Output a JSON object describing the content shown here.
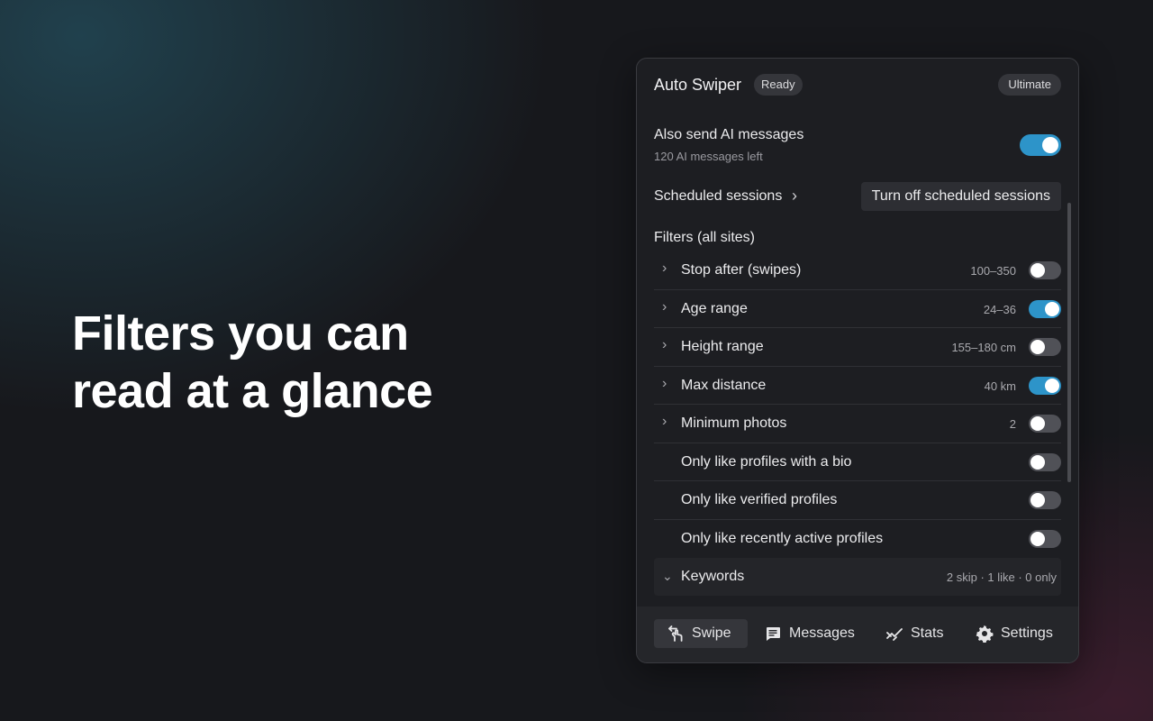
{
  "hero": {
    "headline": "Filters you can\nread at a glance"
  },
  "panel": {
    "title": "Auto Swiper",
    "status": "Ready",
    "plan": "Ultimate",
    "ai": {
      "label": "Also send AI messages",
      "sub": "120 AI messages left",
      "enabled": true
    },
    "scheduled": {
      "label": "Scheduled sessions",
      "button": "Turn off scheduled sessions"
    },
    "filters_heading": "Filters (all sites)",
    "filters": [
      {
        "label": "Stop after (swipes)",
        "value": "100–350",
        "enabled": false,
        "expandable": true
      },
      {
        "label": "Age range",
        "value": "24–36",
        "enabled": true,
        "expandable": true
      },
      {
        "label": "Height range",
        "value": "155–180 cm",
        "enabled": false,
        "expandable": true
      },
      {
        "label": "Max distance",
        "value": "40 km",
        "enabled": true,
        "expandable": true
      },
      {
        "label": "Minimum photos",
        "value": "2",
        "enabled": false,
        "expandable": true
      },
      {
        "label": "Only like profiles with a bio",
        "value": "",
        "enabled": false,
        "expandable": false
      },
      {
        "label": "Only like verified profiles",
        "value": "",
        "enabled": false,
        "expandable": false
      },
      {
        "label": "Only like recently active profiles",
        "value": "",
        "enabled": false,
        "expandable": false
      }
    ],
    "keywords": {
      "label": "Keywords",
      "summary": "2 skip · 1 like · 0 only"
    },
    "tabs": [
      {
        "label": "Swipe",
        "icon": "swipe-icon",
        "active": true
      },
      {
        "label": "Messages",
        "icon": "message-icon",
        "active": false
      },
      {
        "label": "Stats",
        "icon": "stats-icon",
        "active": false
      },
      {
        "label": "Settings",
        "icon": "gear-icon",
        "active": false
      }
    ]
  },
  "colors": {
    "accent": "#2d94c9",
    "panel_bg": "#1d1e22",
    "page_bg": "#17181c"
  }
}
